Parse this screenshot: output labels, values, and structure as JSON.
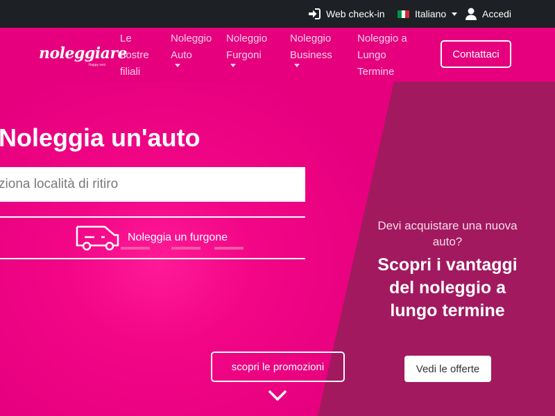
{
  "topbar": {
    "checkin_label": "Web check-in",
    "language_label": "Italiano",
    "login_label": "Accedi"
  },
  "navbar": {
    "logo_text": "noleggiare",
    "logo_tagline": "Happy rent",
    "items": [
      {
        "lines": [
          "Le",
          "nostre",
          "filiali"
        ],
        "has_dropdown": false
      },
      {
        "lines": [
          "Noleggio",
          "Auto"
        ],
        "has_dropdown": true
      },
      {
        "lines": [
          "Noleggio",
          "Furgoni"
        ],
        "has_dropdown": true
      },
      {
        "lines": [
          "Noleggio",
          "Business"
        ],
        "has_dropdown": true
      },
      {
        "lines": [
          "Noleggio a",
          "Lungo",
          "Termine"
        ],
        "has_dropdown": false
      }
    ],
    "contact_label": "Contattaci"
  },
  "hero": {
    "title": "Noleggia un'auto",
    "search_placeholder": "Seleziona località di ritiro",
    "van_link_label": "Noleggia un furgone",
    "promo_button_label": "scopri le promozioni"
  },
  "promo": {
    "subtitle": "Devi acquistare una nuova auto?",
    "headline": "Scopri i vantaggi del noleggio a lungo termine",
    "offers_button_label": "Vedi le offerte"
  },
  "colors": {
    "brand": "#e6007e",
    "panel": "#a2195f",
    "topbar": "#1d2024"
  },
  "icons": [
    "sign-in-icon",
    "italy-flag-icon",
    "user-icon",
    "van-icon",
    "chevron-down-icon"
  ]
}
